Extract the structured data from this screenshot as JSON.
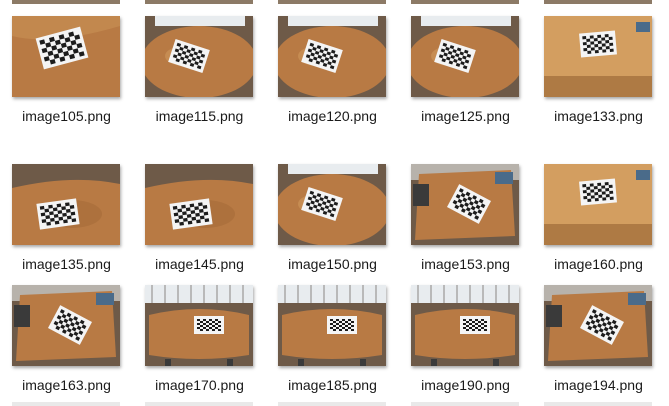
{
  "files": [
    {
      "name": "image105.png",
      "style": "top-flat"
    },
    {
      "name": "image115.png",
      "style": "far"
    },
    {
      "name": "image120.png",
      "style": "far"
    },
    {
      "name": "image125.png",
      "style": "far"
    },
    {
      "name": "image133.png",
      "style": "light"
    },
    {
      "name": "image135.png",
      "style": "tilt"
    },
    {
      "name": "image145.png",
      "style": "tilt"
    },
    {
      "name": "image150.png",
      "style": "far"
    },
    {
      "name": "image153.png",
      "style": "room"
    },
    {
      "name": "image160.png",
      "style": "light"
    },
    {
      "name": "image163.png",
      "style": "room"
    },
    {
      "name": "image170.png",
      "style": "window"
    },
    {
      "name": "image185.png",
      "style": "window"
    },
    {
      "name": "image190.png",
      "style": "window"
    },
    {
      "name": "image194.png",
      "style": "room"
    }
  ],
  "colors": {
    "table": "#b87a44",
    "table_light": "#d39e60",
    "table_dark": "#8a5628",
    "board_white": "#f4f4f4",
    "board_black": "#1c1c1c",
    "floor": "#6e5a48",
    "window": "#e8ecef",
    "chair": "#3a3a3a"
  }
}
